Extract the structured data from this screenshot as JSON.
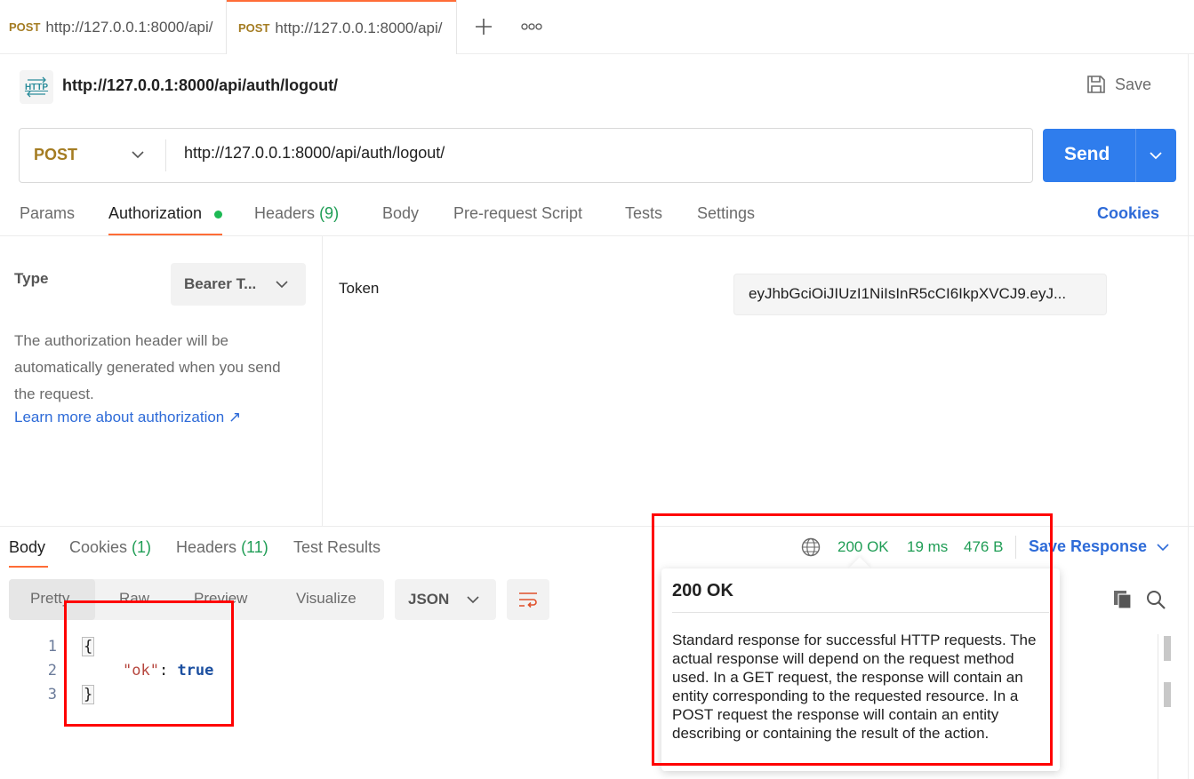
{
  "tabs": [
    {
      "method": "POST",
      "url": "http://127.0.0.1:8000/api/"
    },
    {
      "method": "POST",
      "url": "http://127.0.0.1:8000/api/"
    }
  ],
  "request": {
    "title": "http://127.0.0.1:8000/api/auth/logout/",
    "http_icon_text": "HTTP",
    "save_label": "Save",
    "method": "POST",
    "url": "http://127.0.0.1:8000/api/auth/logout/",
    "send_label": "Send"
  },
  "request_tabs": {
    "params": "Params",
    "authorization": "Authorization",
    "headers": "Headers",
    "headers_count": "(9)",
    "body": "Body",
    "prerequest": "Pre-request Script",
    "tests": "Tests",
    "settings": "Settings",
    "cookies": "Cookies"
  },
  "auth": {
    "type_label": "Type",
    "type_value": "Bearer T...",
    "description": "The authorization header will be automatically generated when you send the request.",
    "learn_more": "Learn more about authorization ↗",
    "token_label": "Token",
    "token_value": "eyJhbGciOiJIUzI1NiIsInR5cCI6IkpXVCJ9.eyJ..."
  },
  "response_tabs": {
    "body": "Body",
    "cookies": "Cookies",
    "cookies_count": "(1)",
    "headers": "Headers",
    "headers_count": "(11)",
    "test_results": "Test Results"
  },
  "status": {
    "code": "200 OK",
    "time": "19 ms",
    "size": "476 B",
    "save_response": "Save Response"
  },
  "view": {
    "pretty": "Pretty",
    "raw": "Raw",
    "preview": "Preview",
    "visualize": "Visualize",
    "format": "JSON"
  },
  "code": {
    "line_numbers": [
      "1",
      "2",
      "3"
    ],
    "open_brace": "{",
    "key": "\"ok\"",
    "colon": ": ",
    "value": "true",
    "close_brace": "}"
  },
  "tooltip": {
    "title": "200 OK",
    "description": "Standard response for successful HTTP requests. The actual response will depend on the request method used. In a GET request, the response will contain an entity corresponding to the requested resource. In a POST request the response will contain an entity describing or containing the result of the action."
  },
  "colors": {
    "accent": "#ff6c37",
    "send": "#2f7ded",
    "method": "#a47c22",
    "status_ok": "#1f9d55",
    "link": "#2e6bd8",
    "highlight": "#ff0000"
  }
}
